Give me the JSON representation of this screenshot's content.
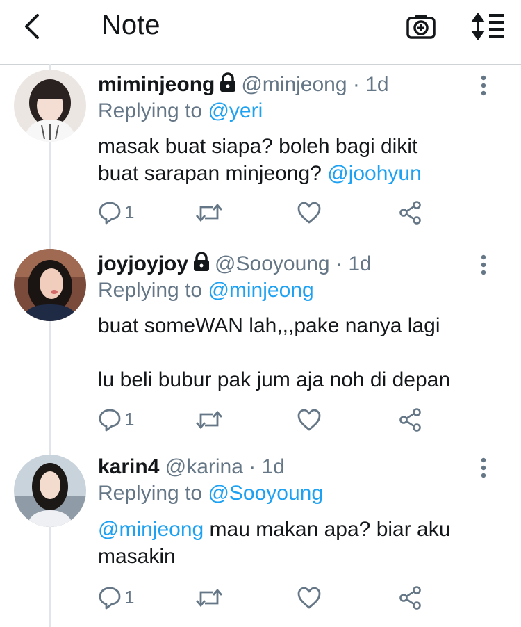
{
  "header": {
    "title": "Note",
    "back_icon": "chevron-left-icon",
    "camera_icon": "camera-plus-icon",
    "sort_icon": "sort-list-icon"
  },
  "colors": {
    "accent": "#1da1f2",
    "secondary_text": "#657786",
    "primary_text": "#14171a",
    "divider": "#e1e5e9"
  },
  "tweets": [
    {
      "display_name": "miminjeong",
      "protected": true,
      "handle": "@minjeong",
      "separator": "·",
      "time": "1d",
      "replying_prefix": "Replying to",
      "replying_to": "@yeri",
      "body_text": "masak buat siapa? boleh bagi dikit\nbuat sarapan minjeong?",
      "body_mention": "@joohyun",
      "reply_count": "1"
    },
    {
      "display_name": "joyjoyjoy",
      "protected": true,
      "handle": "@Sooyoung",
      "separator": "·",
      "time": "1d",
      "replying_prefix": "Replying to",
      "replying_to": "@minjeong",
      "body_text": "buat someWAN lah,,,pake nanya lagi\n\nlu beli bubur pak jum aja noh di depan",
      "reply_count": "1"
    },
    {
      "display_name": "karin4",
      "protected": false,
      "handle": "@karina",
      "separator": "·",
      "time": "1d",
      "replying_prefix": "Replying to",
      "replying_to": "@Sooyoung",
      "body_mention": "@minjeong",
      "body_text": "mau makan apa? biar aku\nmasakin",
      "reply_count": "1"
    }
  ]
}
